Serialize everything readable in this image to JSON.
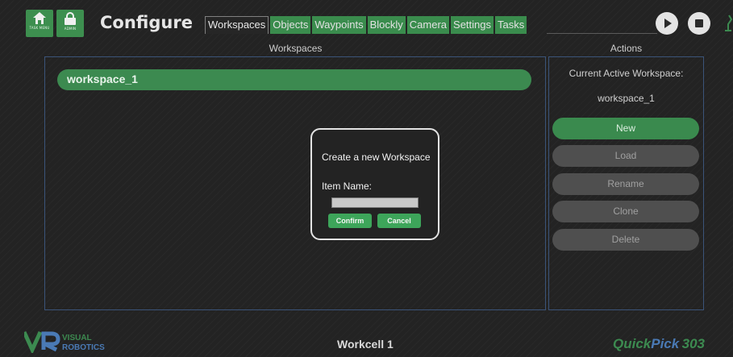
{
  "header": {
    "title": "Configure",
    "task_menu_label": "TASK MENU",
    "admin_label": "ADMIN",
    "tabs": [
      {
        "label": "Workspaces"
      },
      {
        "label": "Objects"
      },
      {
        "label": "Waypoints"
      },
      {
        "label": "Blockly"
      },
      {
        "label": "Camera"
      },
      {
        "label": "Settings"
      },
      {
        "label": "Tasks"
      }
    ],
    "active_tab": "Workspaces"
  },
  "workspaces_panel": {
    "heading": "Workspaces",
    "items": [
      {
        "name": "workspace_1"
      }
    ]
  },
  "actions_panel": {
    "heading": "Actions",
    "current_label": "Current Active Workspace:",
    "current_value": "workspace_1",
    "buttons": [
      {
        "label": "New",
        "enabled": true
      },
      {
        "label": "Load",
        "enabled": false
      },
      {
        "label": "Rename",
        "enabled": false
      },
      {
        "label": "Clone",
        "enabled": false
      },
      {
        "label": "Delete",
        "enabled": false
      }
    ]
  },
  "dialog": {
    "title": "Create a new Workspace",
    "field_label": "Item Name:",
    "field_value": "",
    "confirm_label": "Confirm",
    "cancel_label": "Cancel"
  },
  "footer": {
    "logo_mark": "VR",
    "logo_line1": "VISUAL",
    "logo_line2": "ROBOTICS",
    "workcell": "Workcell 1",
    "product_part1": "Quick",
    "product_part2": "Pick",
    "product_part3": "303"
  },
  "colors": {
    "accent_green": "#3c8a50",
    "panel_border": "#3b5479",
    "disabled_button": "#4f4f4f",
    "background": "#232323"
  },
  "icons": [
    "home-icon",
    "lock-icon",
    "play-icon",
    "stop-icon",
    "robot-arm-icon"
  ]
}
